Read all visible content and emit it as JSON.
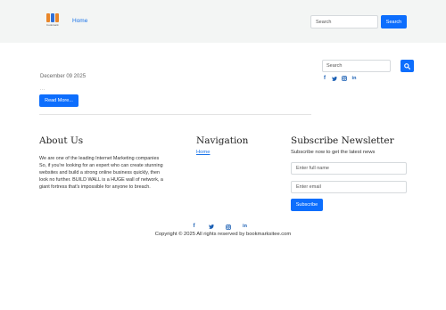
{
  "header": {
    "logo_caption": "bookmark",
    "nav_home": "Home",
    "search_placeholder": "Search",
    "search_button": "Search"
  },
  "main": {
    "post_date": "December 09 2025",
    "excerpt": "...",
    "read_more": "Read More..."
  },
  "sidebar": {
    "search_placeholder": "Search",
    "search_icon": "magnifier-icon",
    "social": [
      "facebook-icon",
      "twitter-icon",
      "instagram-icon",
      "linkedin-icon"
    ]
  },
  "footer": {
    "about_title": "About Us",
    "about_text": "We are one of the leading Internet Marketing companies So, if you're looking for an expert who can create stunning websites and build a strong online business quickly, then look no further. BUILD WALL is a HUGE wall of network, a giant fortress that's impossible for anyone to breach.",
    "navigation_title": "Navigation",
    "navigation_home": "Home",
    "subscribe_title": "Subscribe Newsletter",
    "subscribe_text": "Subscribe now to get the latest news",
    "name_placeholder": "Enter full name",
    "email_placeholder": "Enter email",
    "subscribe_button": "Subscribe",
    "copyright": "Copyright © 2025 All rights reserved by bookmarksitee.com"
  },
  "colors": {
    "accent": "#0d6efd",
    "link": "#1a73e8",
    "header_bg": "#f3f5f4"
  }
}
